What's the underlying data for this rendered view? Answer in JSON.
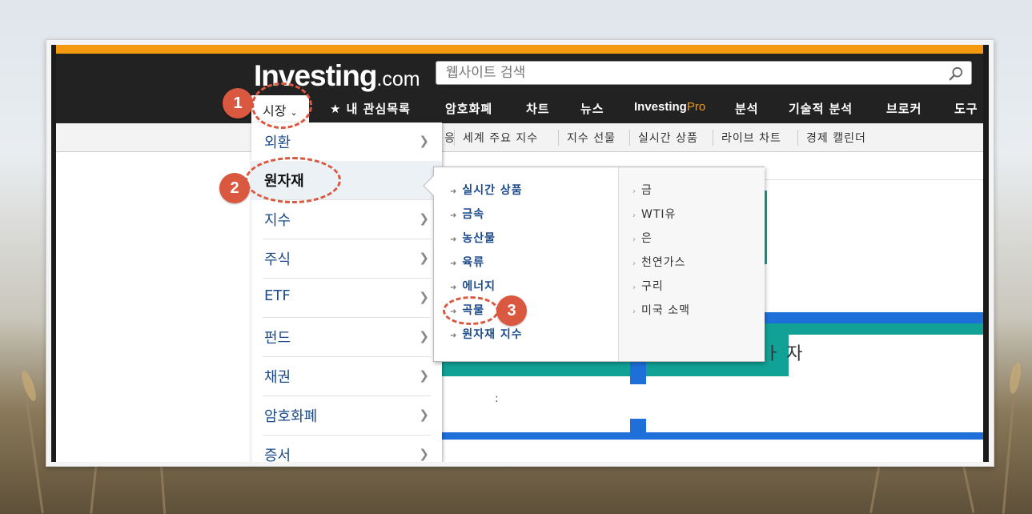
{
  "brand": {
    "logo_main": "Investing",
    "logo_domain": ".com",
    "accent": "#f59a10",
    "badge_color": "#d9583f"
  },
  "search": {
    "placeholder": "웹사이트 검색",
    "icon": "search-icon"
  },
  "nav": {
    "items": [
      {
        "label": "시장"
      },
      {
        "label": "★ 내 관심목록"
      },
      {
        "label": "암호화폐"
      },
      {
        "label": "차트"
      },
      {
        "label": "뉴스"
      },
      {
        "label_main": "Investing",
        "label_accent": "Pro"
      },
      {
        "label": "분석"
      },
      {
        "label": "기술적 분석"
      },
      {
        "label": "브로커"
      },
      {
        "label": "도구"
      }
    ]
  },
  "subnav": {
    "items": [
      {
        "label": "응"
      },
      {
        "label": "세계 주요 지수"
      },
      {
        "label": "지수 선물"
      },
      {
        "label": "실시간 상품"
      },
      {
        "label": "라이브 차트"
      },
      {
        "label": "경제 캘린더"
      }
    ]
  },
  "market_menu": {
    "items": [
      {
        "label": "외환"
      },
      {
        "label": "원자재"
      },
      {
        "label": "지수"
      },
      {
        "label": "주식"
      },
      {
        "label": "ETF"
      },
      {
        "label": "펀드"
      },
      {
        "label": "채권"
      },
      {
        "label": "암호화폐"
      },
      {
        "label": "증서"
      }
    ]
  },
  "commodities_flyout": {
    "left": [
      {
        "label": "실시간 상품"
      },
      {
        "label": "금속"
      },
      {
        "label": "농산물"
      },
      {
        "label": "육류"
      },
      {
        "label": "에너지"
      },
      {
        "label": "곡물"
      },
      {
        "label": "원자재 지수"
      }
    ],
    "right": [
      {
        "label": "금"
      },
      {
        "label": "WTI유"
      },
      {
        "label": "은"
      },
      {
        "label": "천연가스"
      },
      {
        "label": "구리"
      },
      {
        "label": "미국 소맥"
      }
    ]
  },
  "background_page": {
    "partial_text": "ㅏ 자",
    "colon": ":"
  },
  "annotations": {
    "badges": [
      "1",
      "2",
      "3"
    ]
  }
}
